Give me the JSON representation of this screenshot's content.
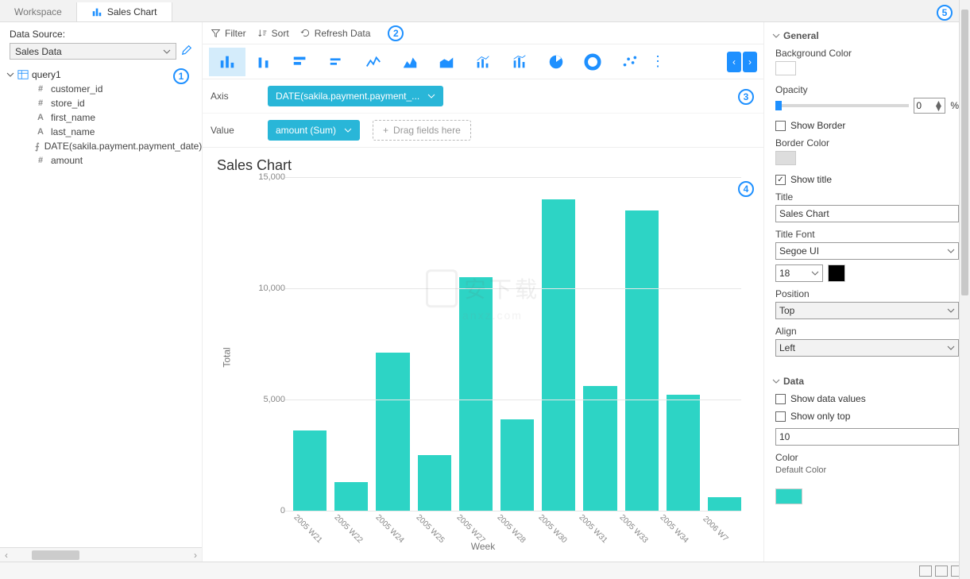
{
  "tabs": {
    "workspace": "Workspace",
    "salesChart": "Sales Chart"
  },
  "sidebar": {
    "dataSourceLabel": "Data Source:",
    "dataSource": "Sales Data",
    "query": "query1",
    "fields": [
      {
        "icon": "#",
        "name": "customer_id"
      },
      {
        "icon": "#",
        "name": "store_id"
      },
      {
        "icon": "A",
        "name": "first_name"
      },
      {
        "icon": "A",
        "name": "last_name"
      },
      {
        "icon": "fx",
        "name": "DATE(sakila.payment.payment_date)"
      },
      {
        "icon": "#",
        "name": "amount"
      }
    ]
  },
  "toolbar": {
    "filter": "Filter",
    "sort": "Sort",
    "refresh": "Refresh Data"
  },
  "shelves": {
    "axisLabel": "Axis",
    "axisPill": "DATE(sakila.payment.payment_...",
    "valueLabel": "Value",
    "valuePill": "amount (Sum)",
    "dropHint": "Drag fields here"
  },
  "chart": {
    "title": "Sales Chart",
    "ylabel": "Total",
    "xlabel": "Week"
  },
  "chart_data": {
    "type": "bar",
    "title": "Sales Chart",
    "xlabel": "Week",
    "ylabel": "Total",
    "ylim": [
      0,
      15000
    ],
    "yticks": [
      0,
      5000,
      10000,
      15000
    ],
    "ytick_labels": [
      "0",
      "5,000",
      "10,000",
      "15,000"
    ],
    "categories": [
      "2005 W21",
      "2005 W22",
      "2005 W24",
      "2005 W25",
      "2005 W27",
      "2005 W28",
      "2005 W30",
      "2005 W31",
      "2005 W33",
      "2005 W34",
      "2006 W7"
    ],
    "values": [
      3600,
      1300,
      7100,
      2500,
      10500,
      4100,
      14000,
      5600,
      13500,
      5200,
      600
    ]
  },
  "props": {
    "generalHeader": "General",
    "bgColor": "Background Color",
    "opacity": "Opacity",
    "opacityVal": "0",
    "opacityUnit": "%",
    "showBorder": "Show Border",
    "borderColor": "Border Color",
    "showTitle": "Show title",
    "titleLabel": "Title",
    "titleVal": "Sales Chart",
    "titleFont": "Title Font",
    "fontVal": "Segoe UI",
    "fontSize": "18",
    "position": "Position",
    "positionVal": "Top",
    "align": "Align",
    "alignVal": "Left",
    "dataHeader": "Data",
    "showDataValues": "Show data values",
    "showOnlyTop": "Show only top",
    "topVal": "10",
    "color": "Color",
    "defaultColor": "Default Color"
  },
  "callouts": {
    "c1": "1",
    "c2": "2",
    "c3": "3",
    "c4": "4",
    "c5": "5"
  }
}
